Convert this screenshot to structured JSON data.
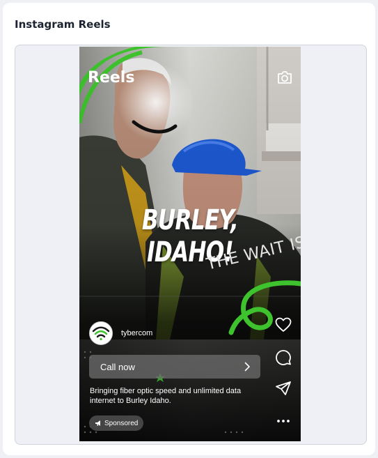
{
  "panel": {
    "title": "Instagram Reels"
  },
  "reel": {
    "header_title": "Reels",
    "headline": "BURLEY, IDAHO!",
    "subheadline": "THE WAIT IS O",
    "account_name": "tybercom",
    "cta_label": "Call now",
    "caption": "Bringing fiber optic speed and unlimited data internet to Burley Idaho.",
    "sponsored_label": "Sponsored"
  },
  "icons": {
    "camera": "camera-icon",
    "chevron": "chevron-right-icon",
    "like": "heart-icon",
    "comment": "comment-icon",
    "share": "send-icon",
    "more": "more-icon",
    "megaphone": "megaphone-icon",
    "avatar_logo": "wifi-logo"
  },
  "colors": {
    "brand_green": "#3ec22d",
    "hardhat_blue": "#1d5bd6"
  }
}
